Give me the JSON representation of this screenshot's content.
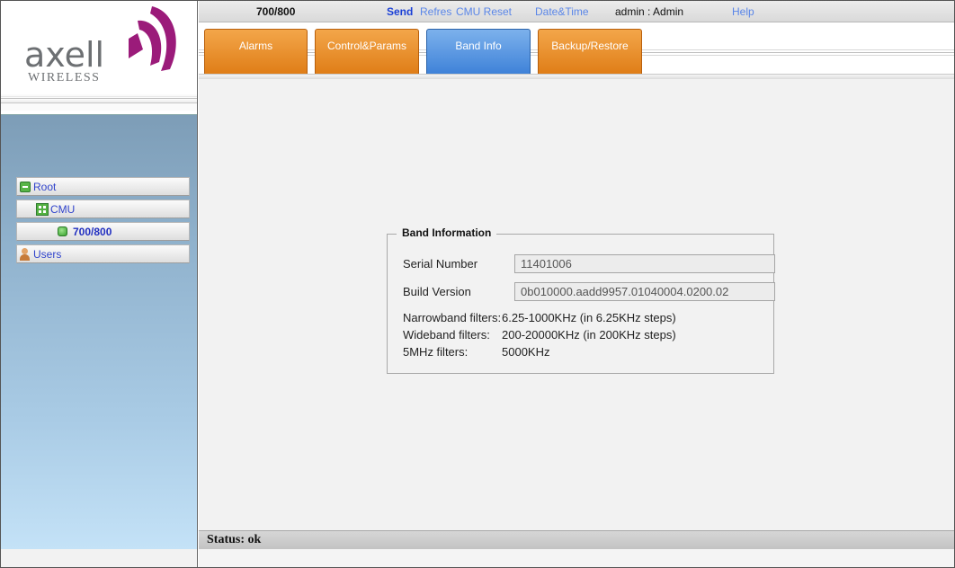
{
  "logo": {
    "word": "axell",
    "sub": "WIRELESS",
    "brand_color": "#9b1b7a"
  },
  "topbar": {
    "device": "700/800",
    "send": "Send",
    "refresh": "Refres",
    "cmu_reset": "CMU Reset",
    "date_time": "Date&Time",
    "user": "admin : Admin",
    "help": "Help"
  },
  "tabs": [
    {
      "label": "Alarms",
      "active": false
    },
    {
      "label": "Control&Params",
      "active": false
    },
    {
      "label": "Band Info",
      "active": true
    },
    {
      "label": "Backup/Restore",
      "active": false
    }
  ],
  "tree": {
    "root": "Root",
    "cmu": "CMU",
    "node": "700/800",
    "users": "Users"
  },
  "band_info": {
    "legend": "Band Information",
    "serial_label": "Serial Number",
    "serial_value": "11401006",
    "build_label": "Build Version",
    "build_value": "0b010000.aadd9957.01040004.0200.02",
    "narrowband_label": "Narrowband filters:",
    "narrowband_value": "6.25-1000KHz (in 6.25KHz steps)",
    "wideband_label": "Wideband filters:",
    "wideband_value": "200-20000KHz (in 200KHz steps)",
    "fivemhz_label": "5MHz filters:",
    "fivemhz_value": "5000KHz"
  },
  "status": "Status: ok",
  "colors": {
    "tab_orange": "#e8891f",
    "tab_blue": "#4a8ae0",
    "link_blue": "#1a3fd6"
  }
}
